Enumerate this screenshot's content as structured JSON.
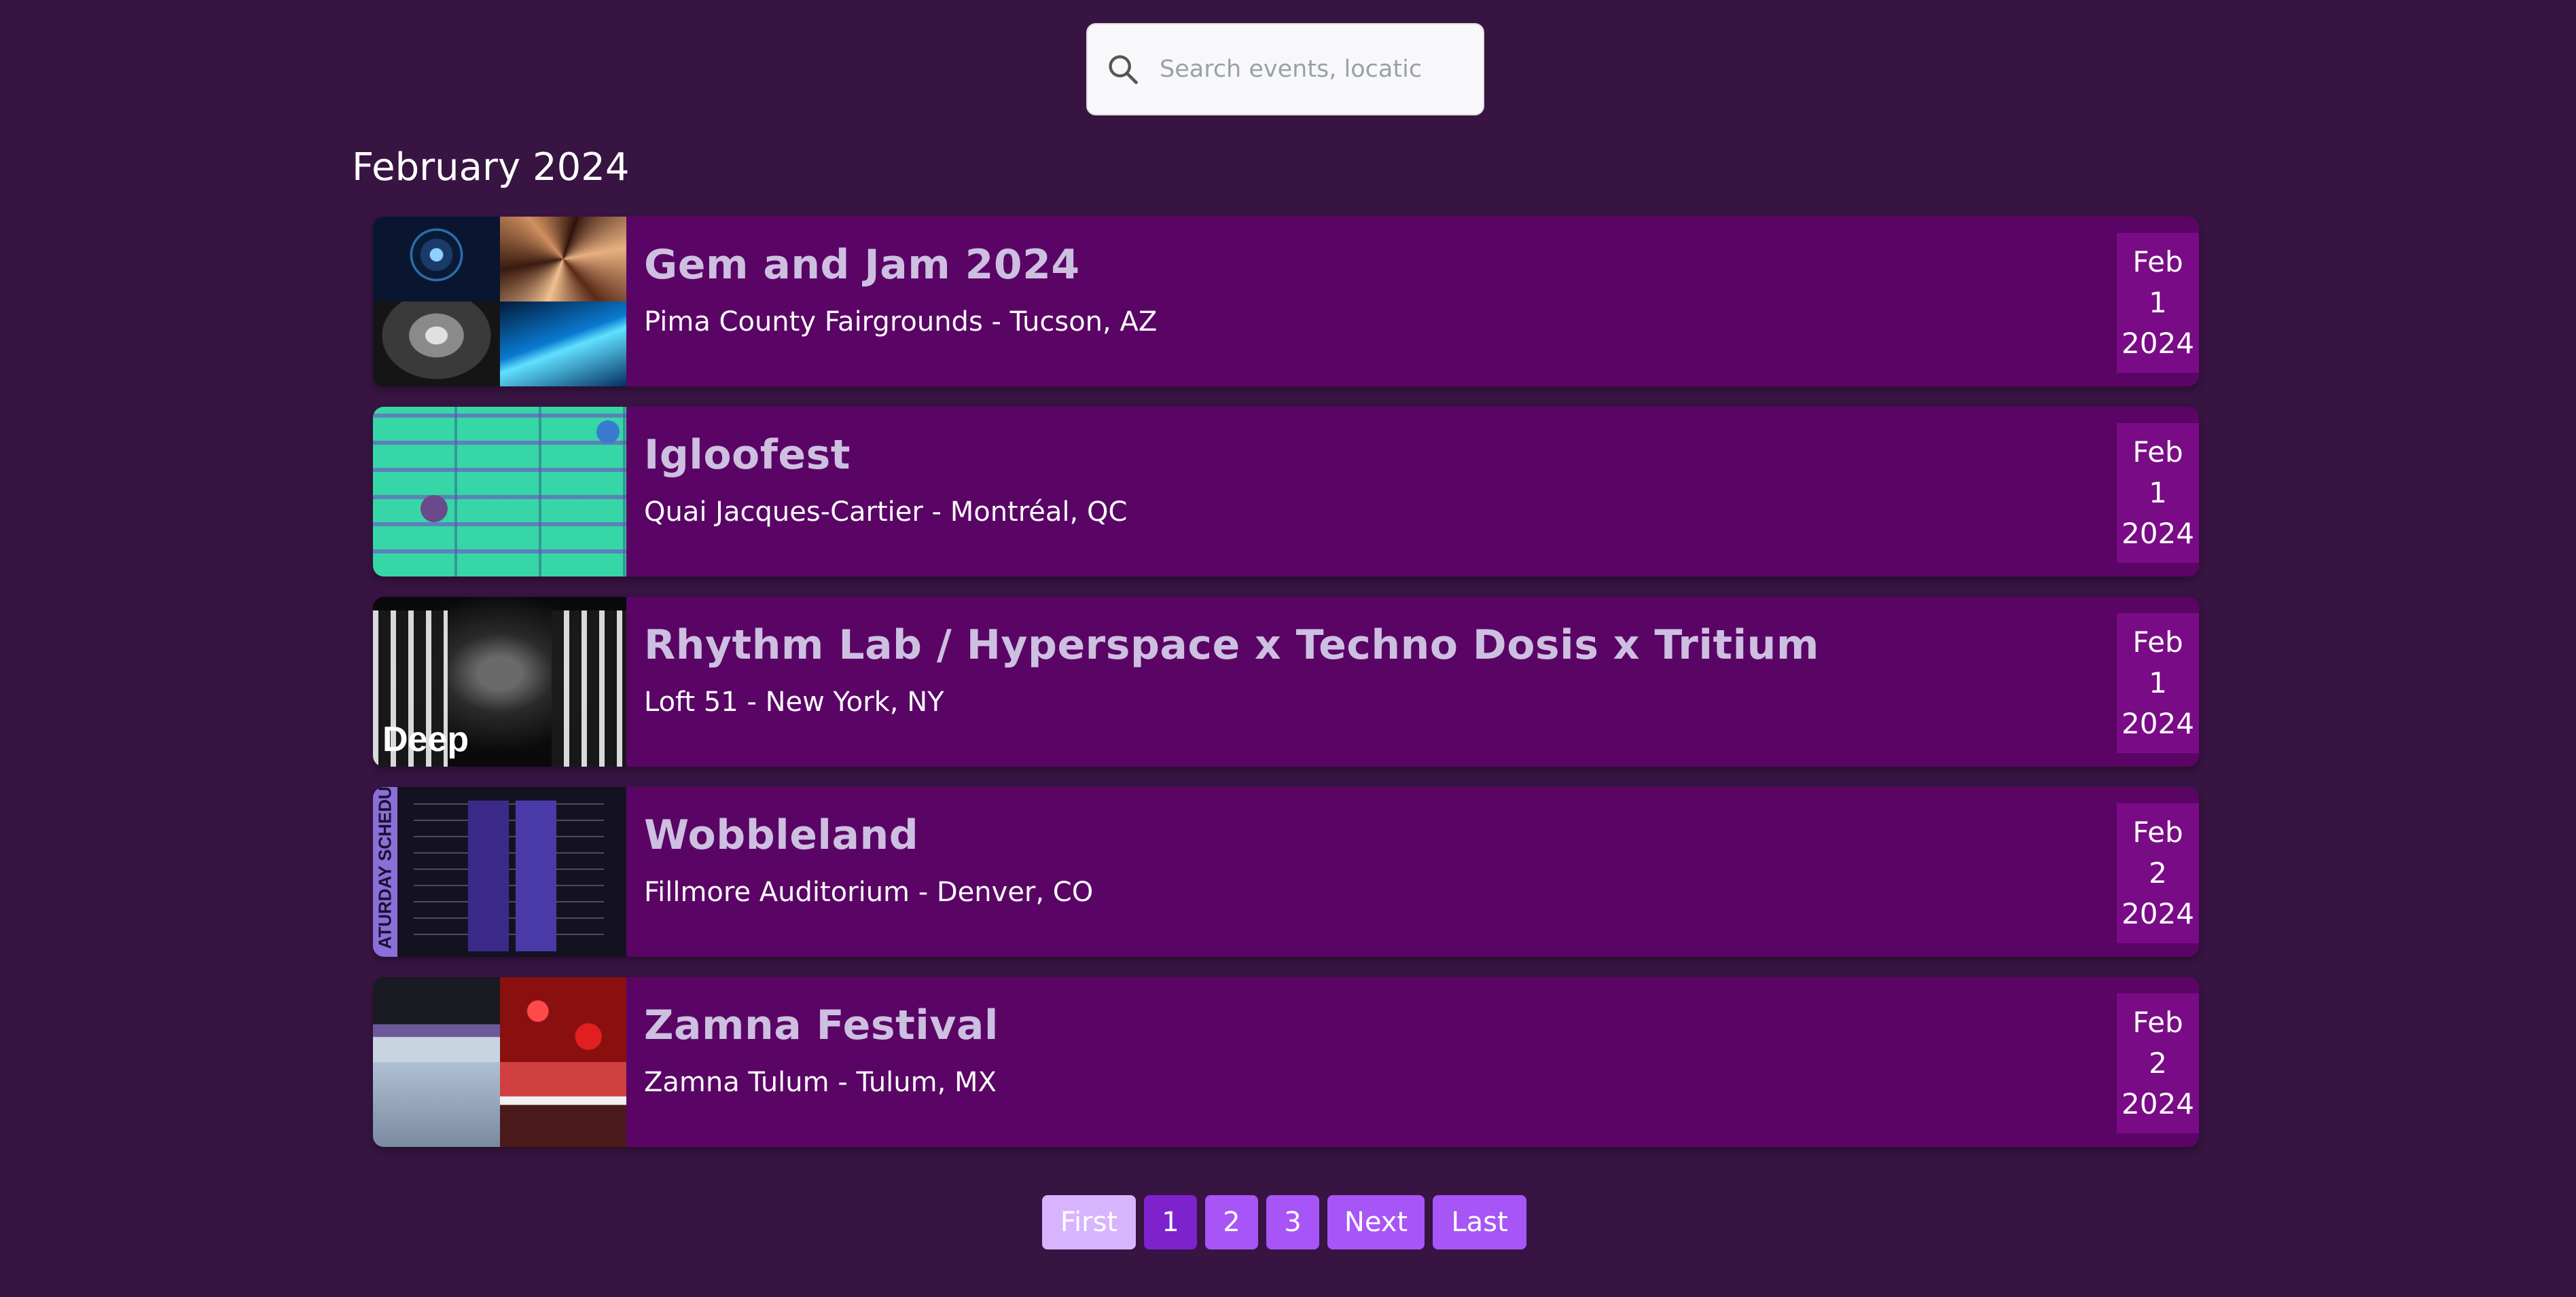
{
  "search": {
    "placeholder": "Search events, locatic"
  },
  "month_heading": "February 2024",
  "events": [
    {
      "title": "Gem and Jam 2024",
      "location": "Pima County Fairgrounds - Tucson, AZ",
      "month": "Feb",
      "day": "1",
      "year": "2024"
    },
    {
      "title": "Igloofest",
      "location": "Quai Jacques-Cartier - Montréal, QC",
      "month": "Feb",
      "day": "1",
      "year": "2024"
    },
    {
      "title": "Rhythm Lab / Hyperspace x Techno Dosis x Tritium",
      "location": "Loft 51 - New York, NY",
      "month": "Feb",
      "day": "1",
      "year": "2024",
      "thumb_text": "Deep"
    },
    {
      "title": "Wobbleland",
      "location": "Fillmore Auditorium - Denver, CO",
      "month": "Feb",
      "day": "2",
      "year": "2024",
      "thumb_text": "ATURDAY SCHEDUL"
    },
    {
      "title": "Zamna Festival",
      "location": "Zamna Tulum - Tulum, MX",
      "month": "Feb",
      "day": "2",
      "year": "2024"
    }
  ],
  "pagination": {
    "first": "First",
    "pages": [
      "1",
      "2",
      "3"
    ],
    "next": "Next",
    "last": "Last",
    "current": "1"
  },
  "colors": {
    "background": "#371441",
    "card": "#5a0566",
    "date_box": "#7a0b86",
    "title": "#cdbfe0",
    "page_btn": "#a855f7",
    "page_active": "#7e22ce",
    "page_disabled": "#d8b4fe"
  }
}
